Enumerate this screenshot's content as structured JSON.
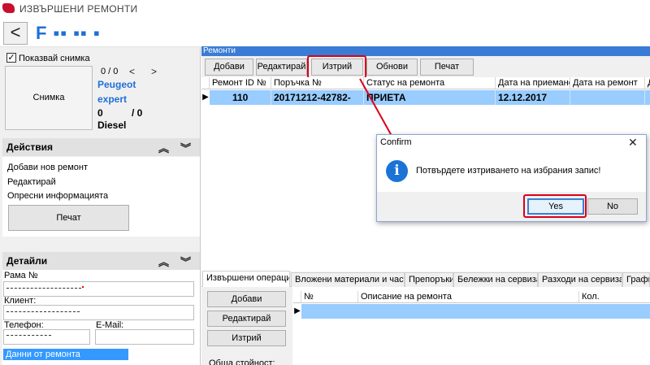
{
  "window": {
    "title": "ИЗВЪРШЕНИ РЕМОНТИ"
  },
  "header": {
    "back_label": "<",
    "plate": "F ▪▪ ▪▪ ▪"
  },
  "left": {
    "show_photo_label": "Показвай снимка",
    "show_photo_checked": true,
    "photo_button": "Снимка",
    "photo_counter": "0 / 0",
    "prev_arrow": "<",
    "next_arrow": ">",
    "car_make": "Peugeot",
    "car_model": "expert",
    "km_a": "0",
    "km_sep": "/ 0",
    "fuel": "Diesel",
    "actions": {
      "title": "Действия",
      "items": [
        "Добави нов ремонт",
        "Редактирай",
        "Опресни информацията"
      ],
      "print_button": "Печат"
    },
    "details": {
      "title": "Детайли",
      "vin_label": "Рама №",
      "client_label": "Клиент:",
      "phone_label": "Телефон:",
      "email_label": "E-Mail:",
      "repair_data_label": "Данни от ремонта"
    }
  },
  "grid": {
    "caption": "Ремонти",
    "toolbar": [
      "Добави",
      "Редактирай",
      "Изтрий",
      "Обнови",
      "Печат"
    ],
    "columns": [
      "Ремонт ID №",
      "Поръчка №",
      "Статус на ремонта",
      "Дата на приемане",
      "Дата на ремонт",
      "Д"
    ],
    "rows": [
      {
        "id": "110",
        "order": "20171212-42782-",
        "status": "ПРИЕТА",
        "received": "12.12.2017",
        "repaired": ""
      }
    ],
    "selected_marker": "▶"
  },
  "dialog": {
    "title": "Confirm",
    "close": "✕",
    "message": "Потвърдете изтриването на избрания запис!",
    "yes": "Yes",
    "no": "No",
    "info_glyph": "i"
  },
  "bottom": {
    "tabs": [
      "Извършени операции",
      "Вложени материали и части",
      "Препоръки",
      "Бележки на сервиза",
      "Разходи на сервиза",
      "Графи"
    ],
    "active_tab": 0,
    "ops_buttons": [
      "Добави",
      "Редактирай",
      "Изтрий"
    ],
    "total_label": "Обща стойност:",
    "sub_columns": [
      "№",
      "Описание на ремонта",
      "Кол."
    ],
    "selected_marker": "▶"
  },
  "colors": {
    "accent": "#3a7bd5",
    "selection": "#99ccff",
    "highlight": "#d9001b",
    "plate": "#1f6fd6"
  }
}
